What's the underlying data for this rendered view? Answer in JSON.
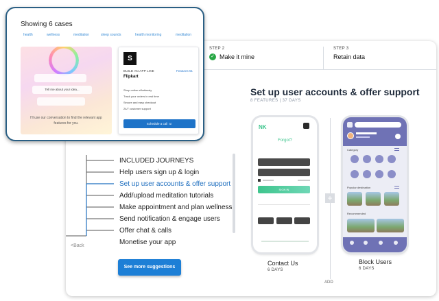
{
  "steps": [
    {
      "number": "STEP 2",
      "label": "Make it mine"
    },
    {
      "number": "STEP 3",
      "label": "Retain data"
    }
  ],
  "headline": "Set up user accounts & offer support",
  "subhead": "8 FEATURES  |  37 DAYS",
  "journeys": [
    "INCLUDED JOURNEYS",
    "Help users sign up & login",
    "Set up user accounts & offer support",
    "Add/upload meditation tutorials",
    "Make appointment and plan wellness",
    "Send notification & engage users",
    "Offer chat & calls",
    "Monetise your app"
  ],
  "back_label": "<Back",
  "suggest_button": "See more suggestions",
  "phones": [
    {
      "title": "Contact Us",
      "days": "6 DAYS",
      "logo": "NK",
      "screen_heading": "Forgot?",
      "signin": "SIGN IN"
    },
    {
      "title": "Block Users",
      "days": "6 DAYS",
      "welcome": "Welcome",
      "category": "Category",
      "popular": "Popular destination",
      "recent": "Recommended"
    }
  ],
  "add_label": "ADD",
  "plus": "+",
  "overlay": {
    "title": "Showing 6 cases",
    "tags": [
      "health",
      "wellness",
      "meditation",
      "sleep sounds",
      "health monitoring",
      "meditation"
    ],
    "chat_prompt": "Tell me about your idea...",
    "note": "I'll use our conversation to find the relevant app features for you.",
    "brand_logo": "S",
    "build_label": "BUILD AN APP LIKE",
    "features_label": "Features 51",
    "app_name": "Flipkart",
    "feature_list": [
      "Shop online effortlessly",
      "Track your orders in real time",
      "Secure and easy checkout",
      "24/7 customer support"
    ],
    "schedule_button": "Schedule a call"
  },
  "colors": {
    "accent": "#1d7fd6",
    "dark_border": "#2a5f84",
    "check": "#28a745",
    "phone_purple": "#6f72b5",
    "phone_green": "#3ec58d"
  }
}
